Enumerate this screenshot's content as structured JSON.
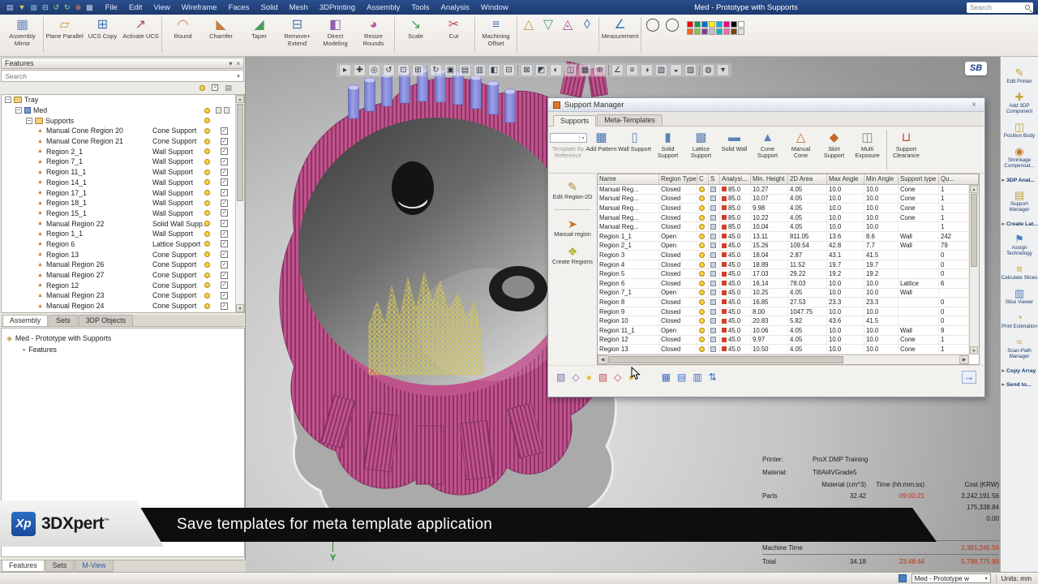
{
  "titlebar": {
    "title": "Med - Prototype with Supports",
    "menus": [
      "File",
      "Edit",
      "View",
      "Wireframe",
      "Faces",
      "Solid",
      "Mesh",
      "3DPrinting",
      "Assembly",
      "Tools",
      "Analysis",
      "Window"
    ],
    "search_placeholder": "Search",
    "quick_icons": [
      {
        "name": "new-file-icon",
        "glyph": "▤",
        "color": "#cdd6e8"
      },
      {
        "name": "open-file-icon",
        "glyph": "▼",
        "color": "#e8c46a"
      },
      {
        "name": "save-icon",
        "glyph": "▦",
        "color": "#7fa8d8"
      },
      {
        "name": "print-icon",
        "glyph": "⊟",
        "color": "#cdd6e8"
      },
      {
        "name": "undo-icon",
        "glyph": "↺",
        "color": "#9fd88a"
      },
      {
        "name": "redo-icon",
        "glyph": "↻",
        "color": "#9fd88a"
      },
      {
        "name": "ucs-icon",
        "glyph": "⊕",
        "color": "#e8886a"
      },
      {
        "name": "grid-icon",
        "glyph": "▩",
        "color": "#cdd6e8"
      }
    ]
  },
  "ribbon": {
    "items": [
      {
        "label": "Assembly Mirror",
        "glyph": "▦",
        "color": "#6f8fbf",
        "sep": true
      },
      {
        "label": "Plane Parallel",
        "glyph": "▱",
        "color": "#c79a3a"
      },
      {
        "label": "UCS Copy",
        "glyph": "⊞",
        "color": "#4472b0"
      },
      {
        "label": "Activate UCS",
        "glyph": "↗",
        "color": "#b05050",
        "sep": true
      },
      {
        "label": "Round",
        "glyph": "◠",
        "color": "#c77d46"
      },
      {
        "label": "Chamfer",
        "glyph": "◣",
        "color": "#c77d46"
      },
      {
        "label": "Taper",
        "glyph": "◢",
        "color": "#4a9e5c"
      },
      {
        "label": "Remove+ Extend",
        "glyph": "⊟",
        "color": "#4472b0"
      },
      {
        "label": "Direct Modeling",
        "glyph": "◧",
        "color": "#8f5fb0"
      },
      {
        "label": "Resize Rounds",
        "glyph": "◕",
        "color": "#b0569a",
        "sep": true
      },
      {
        "label": "Scale",
        "glyph": "↘",
        "color": "#4a9e5c"
      },
      {
        "label": "Cut",
        "glyph": "✂",
        "color": "#b05050",
        "sep": true
      },
      {
        "label": "Machining Offset",
        "glyph": "≡",
        "color": "#4472b0",
        "sep": true
      },
      {
        "label": "",
        "glyph": "△",
        "color": "#c79a3a"
      },
      {
        "label": "",
        "glyph": "▽",
        "color": "#4a9e5c"
      },
      {
        "label": "",
        "glyph": "◬",
        "color": "#b0569a"
      },
      {
        "label": "",
        "glyph": "◊",
        "color": "#4472b0",
        "sep": true
      },
      {
        "label": "Measurement",
        "glyph": "∠",
        "color": "#3a7ec2",
        "sep": true
      },
      {
        "label": "",
        "glyph": "◯",
        "color": "#555555"
      },
      {
        "label": "",
        "glyph": "◯",
        "color": "#555555"
      }
    ],
    "palette": [
      "#ff0000",
      "#00a650",
      "#0072bc",
      "#fff200",
      "#00aeef",
      "#ec008c",
      "#000000",
      "#ffffff",
      "#f26522",
      "#8dc63f",
      "#7d4199",
      "#c0c0c0",
      "#00b7c6",
      "#f06eaa",
      "#804000",
      "#e0e0e0"
    ]
  },
  "viewport_toolbar": [
    {
      "name": "select-icon",
      "glyph": "▸"
    },
    {
      "name": "pan-icon",
      "glyph": "✚"
    },
    {
      "name": "zoom-icon",
      "glyph": "◎"
    },
    {
      "name": "rotate-icon",
      "glyph": "↺"
    },
    {
      "name": "zoom-fit-icon",
      "glyph": "⊡"
    },
    {
      "name": "zoom-window-icon",
      "glyph": "⊞"
    },
    {
      "name": "previous-view-icon",
      "glyph": "↻"
    },
    {
      "name": "shade-icon",
      "glyph": "▣"
    },
    {
      "name": "wireframe-icon",
      "glyph": "▤"
    },
    {
      "name": "hidden-line-icon",
      "glyph": "▥"
    },
    {
      "name": "perspective-icon",
      "glyph": "◧"
    },
    {
      "name": "view-top-icon",
      "glyph": "⊟"
    },
    {
      "name": "view-front-icon",
      "glyph": "⊠"
    },
    {
      "name": "view-iso-icon",
      "glyph": "◩"
    },
    {
      "name": "light-icon",
      "glyph": "◐"
    },
    {
      "name": "section-icon",
      "glyph": "◫"
    },
    {
      "name": "grid-toggle-icon",
      "glyph": "▦"
    },
    {
      "name": "ucs-toggle-icon",
      "glyph": "⊕"
    },
    {
      "name": "axis-icon",
      "glyph": "∠"
    },
    {
      "name": "measure-icon",
      "glyph": "≡"
    },
    {
      "name": "display-mode-icon",
      "glyph": "◑"
    },
    {
      "name": "layers-icon",
      "glyph": "▧"
    },
    {
      "name": "background-icon",
      "glyph": "◒"
    },
    {
      "name": "snapshot-icon",
      "glyph": "▨"
    },
    {
      "name": "settings-icon",
      "glyph": "◍"
    },
    {
      "name": "more-icon",
      "glyph": "▾"
    }
  ],
  "features_panel": {
    "title": "Features",
    "search_placeholder": "Search",
    "tabs": [
      "Assembly",
      "Sets",
      "3DP Objects"
    ],
    "tree": [
      {
        "label": "Tray",
        "level": 0,
        "expander": true,
        "icon": "folder"
      },
      {
        "label": "Med",
        "level": 1,
        "expander": true,
        "icon": "part"
      },
      {
        "label": "Supports",
        "level": 2,
        "expander": true,
        "icon": "folder"
      },
      {
        "label": "Manual Cone Region 20",
        "type": "Cone Support",
        "level": 3
      },
      {
        "label": "Manual Cone Region 21",
        "type": "Cone Support",
        "level": 3
      },
      {
        "label": "Region 2_1",
        "type": "Wall Support",
        "level": 3
      },
      {
        "label": "Region 7_1",
        "type": "Wall Support",
        "level": 3
      },
      {
        "label": "Region 11_1",
        "type": "Wall Support",
        "level": 3
      },
      {
        "label": "Region 14_1",
        "type": "Wall Support",
        "level": 3
      },
      {
        "label": "Region 17_1",
        "type": "Wall Support",
        "level": 3
      },
      {
        "label": "Region 18_1",
        "type": "Wall Support",
        "level": 3
      },
      {
        "label": "Region 15_1",
        "type": "Wall Support",
        "level": 3
      },
      {
        "label": "Manual Region 22",
        "type": "Solid Wall Supp...",
        "level": 3
      },
      {
        "label": "Region 1_1",
        "type": "Wall Support",
        "level": 3
      },
      {
        "label": "Region 6",
        "type": "Lattice Support",
        "level": 3
      },
      {
        "label": "Region 13",
        "type": "Cone Support",
        "level": 3
      },
      {
        "label": "Manual Region 26",
        "type": "Cone Support",
        "level": 3
      },
      {
        "label": "Manual Region 27",
        "type": "Cone Support",
        "level": 3
      },
      {
        "label": "Region 12",
        "type": "Cone Support",
        "level": 3
      },
      {
        "label": "Manual Region 23",
        "type": "Cone Support",
        "level": 3
      },
      {
        "label": "Manual Region 24",
        "type": "Cone Support",
        "level": 3
      }
    ]
  },
  "assembly_panel": {
    "root": "Med - Prototype with Supports",
    "child": "Features"
  },
  "bottom_tabs": [
    "Features",
    "Sets",
    "M-View"
  ],
  "support_manager": {
    "title": "Support Manager",
    "tabs": [
      "Supports",
      "Meta-Templates"
    ],
    "toolbar": [
      {
        "label": "Template By Reference",
        "glyph": "▤",
        "color": "#999999",
        "disabled": true
      },
      {
        "label": "Add Pattern",
        "glyph": "▦",
        "color": "#4472b0"
      },
      {
        "label": "Wall Support",
        "glyph": "▯",
        "color": "#5a83b5"
      },
      {
        "label": "Solid Support",
        "glyph": "▮",
        "color": "#5a83b5"
      },
      {
        "label": "Lattice Support",
        "glyph": "▩",
        "color": "#5a83b5"
      },
      {
        "label": "Solid Wall",
        "glyph": "▬",
        "color": "#5a83b5"
      },
      {
        "label": "Cone Support",
        "glyph": "▲",
        "color": "#5a83b5"
      },
      {
        "label": "Manual Cone",
        "glyph": "△",
        "color": "#c26a2a"
      },
      {
        "label": "Skirt Support",
        "glyph": "◆",
        "color": "#c26a2a"
      },
      {
        "label": "Multi Exposure",
        "glyph": "◫",
        "color": "#888888",
        "sep_after": true
      },
      {
        "label": "Support Clearance",
        "glyph": "⊔",
        "color": "#c24a2a"
      }
    ],
    "side_tools": [
      {
        "label": "Edit Region-2D",
        "glyph": "✎",
        "color": "#b08a2a"
      },
      {
        "label": "Manual region",
        "glyph": "➤",
        "color": "#c2742a"
      },
      {
        "label": "Create Regions",
        "glyph": "❖",
        "color": "#b0b02a"
      }
    ],
    "table": {
      "columns": [
        "Name",
        "Region Type",
        "C",
        "S",
        "Analysi...",
        "Min. Height",
        "2D Area",
        "Max Angle",
        "Min Angle",
        "Support type",
        "Qu..."
      ],
      "rows": [
        {
          "name": "Manual Reg...",
          "region_type": "Closed",
          "analysis": "85.0",
          "min_height": "10.27",
          "area": "4.05",
          "max_angle": "10.0",
          "min_angle": "10.0",
          "support_type": "Cone",
          "qty": "1"
        },
        {
          "name": "Manual Reg...",
          "region_type": "Closed",
          "analysis": "85.0",
          "min_height": "10.07",
          "area": "4.05",
          "max_angle": "10.0",
          "min_angle": "10.0",
          "support_type": "Cone",
          "qty": "1"
        },
        {
          "name": "Manual Reg...",
          "region_type": "Closed",
          "analysis": "85.0",
          "min_height": "9.98",
          "area": "4.05",
          "max_angle": "10.0",
          "min_angle": "10.0",
          "support_type": "Cone",
          "qty": "1"
        },
        {
          "name": "Manual Reg...",
          "region_type": "Closed",
          "analysis": "85.0",
          "min_height": "10.22",
          "area": "4.05",
          "max_angle": "10.0",
          "min_angle": "10.0",
          "support_type": "Cone",
          "qty": "1"
        },
        {
          "name": "Manual Reg...",
          "region_type": "Closed",
          "analysis": "85.0",
          "min_height": "10.04",
          "area": "4.05",
          "max_angle": "10.0",
          "min_angle": "10.0",
          "support_type": "",
          "qty": "1"
        },
        {
          "name": "Region 1_1",
          "region_type": "Open",
          "analysis": "45.0",
          "min_height": "13.11",
          "area": "811.05",
          "max_angle": "13.6",
          "min_angle": "8.6",
          "support_type": "Wall",
          "qty": "242"
        },
        {
          "name": "Region 2_1",
          "region_type": "Open",
          "analysis": "45.0",
          "min_height": "15.26",
          "area": "109.54",
          "max_angle": "42.8",
          "min_angle": "7.7",
          "support_type": "Wall",
          "qty": "79"
        },
        {
          "name": "Region 3",
          "region_type": "Closed",
          "analysis": "45.0",
          "min_height": "18.04",
          "area": "2.87",
          "max_angle": "43.1",
          "min_angle": "41.5",
          "support_type": "",
          "qty": "0"
        },
        {
          "name": "Region 4",
          "region_type": "Closed",
          "analysis": "45.0",
          "min_height": "18.89",
          "area": "11.52",
          "max_angle": "19.7",
          "min_angle": "19.7",
          "support_type": "",
          "qty": "0"
        },
        {
          "name": "Region 5",
          "region_type": "Closed",
          "analysis": "45.0",
          "min_height": "17.03",
          "area": "29.22",
          "max_angle": "19.2",
          "min_angle": "19.2",
          "support_type": "",
          "qty": "0"
        },
        {
          "name": "Region 6",
          "region_type": "Closed",
          "analysis": "45.0",
          "min_height": "16.14",
          "area": "78.03",
          "max_angle": "10.0",
          "min_angle": "10.0",
          "support_type": "Lattice",
          "qty": "6"
        },
        {
          "name": "Region 7_1",
          "region_type": "Open",
          "analysis": "45.0",
          "min_height": "10.25",
          "area": "4.05",
          "max_angle": "10.0",
          "min_angle": "10.0",
          "support_type": "Wall",
          "qty": ""
        },
        {
          "name": "Region 8",
          "region_type": "Closed",
          "analysis": "45.0",
          "min_height": "16.85",
          "area": "27.53",
          "max_angle": "23.3",
          "min_angle": "23.3",
          "support_type": "",
          "qty": "0"
        },
        {
          "name": "Region 9",
          "region_type": "Closed",
          "analysis": "45.0",
          "min_height": "8.00",
          "area": "1047.75",
          "max_angle": "10.0",
          "min_angle": "10.0",
          "support_type": "",
          "qty": "0"
        },
        {
          "name": "Region 10",
          "region_type": "Closed",
          "analysis": "45.0",
          "min_height": "20.83",
          "area": "5.82",
          "max_angle": "43.6",
          "min_angle": "41.5",
          "support_type": "",
          "qty": "0"
        },
        {
          "name": "Region 11_1",
          "region_type": "Open",
          "analysis": "45.0",
          "min_height": "10.06",
          "area": "4.05",
          "max_angle": "10.0",
          "min_angle": "10.0",
          "support_type": "Wall",
          "qty": "9"
        },
        {
          "name": "Region 12",
          "region_type": "Closed",
          "analysis": "45.0",
          "min_height": "9.97",
          "area": "4.05",
          "max_angle": "10.0",
          "min_angle": "10.0",
          "support_type": "Cone",
          "qty": "1"
        },
        {
          "name": "Region 13",
          "region_type": "Closed",
          "analysis": "45.0",
          "min_height": "10.50",
          "area": "4.05",
          "max_angle": "10.0",
          "min_angle": "10.0",
          "support_type": "Cone",
          "qty": "1"
        }
      ]
    },
    "bottom_toolbar": [
      {
        "name": "show-solid-icon",
        "glyph": "▧",
        "color": "#7a6ab0"
      },
      {
        "name": "show-region-icon",
        "glyph": "◇",
        "color": "#7a6ab0"
      },
      {
        "name": "highlight-on-icon",
        "glyph": "●",
        "color": "#e8c53a"
      },
      {
        "name": "hide-solid-icon",
        "glyph": "▧",
        "color": "#c05050"
      },
      {
        "name": "hide-region-icon",
        "glyph": "◇",
        "color": "#c05050"
      },
      {
        "name": "highlight-off-icon",
        "glyph": "●",
        "color": "#e8c53a",
        "sep": true
      },
      {
        "name": "table-view-icon",
        "glyph": "▦",
        "color": "#3a6ec2"
      },
      {
        "name": "table-edit-icon",
        "glyph": "▤",
        "color": "#3a6ec2"
      },
      {
        "name": "table-filter-icon",
        "glyph": "▥",
        "color": "#3a6ec2"
      },
      {
        "name": "sort-ascending-icon",
        "glyph": "⇅",
        "color": "#3a6ec2"
      }
    ],
    "apply_glyph": "→"
  },
  "right_sidebar": [
    {
      "label": "Edit Printer",
      "glyph": "✎",
      "color": "#c7a23a"
    },
    {
      "label": "Add 3DP Component",
      "glyph": "✚",
      "color": "#c7a23a"
    },
    {
      "label": "Position Body",
      "glyph": "◫",
      "color": "#c7a23a"
    },
    {
      "label": "Shrinkage Compensat...",
      "glyph": "◉",
      "color": "#c7762a"
    },
    {
      "label": "3DP Anal...",
      "group": true
    },
    {
      "label": "Support Manager",
      "glyph": "▤",
      "color": "#c7a23a"
    },
    {
      "label": "Create Lat...",
      "group": true
    },
    {
      "label": "Assign Technology",
      "glyph": "⚑",
      "color": "#4a7ec2"
    },
    {
      "label": "Calculate Slices",
      "glyph": "≡",
      "color": "#c7a23a"
    },
    {
      "label": "Slice Viewer",
      "glyph": "▥",
      "color": "#4a7ec2"
    },
    {
      "label": "Print Estimation",
      "glyph": "◔",
      "color": "#c7a23a"
    },
    {
      "label": "Scan-Path Manager",
      "glyph": "≈",
      "color": "#c7a23a"
    },
    {
      "label": "Copy Array",
      "group": true
    },
    {
      "label": "Send to...",
      "group": true
    }
  ],
  "build_info": {
    "printer_label": "Printer:",
    "printer_value": "ProX DMP Training",
    "material_label": "Material:",
    "material_value": "Ti6Al4VGrade5",
    "col_headers": [
      "Material (cm^3)",
      "Time (hh:mm:ss)",
      "Cost (KRW)"
    ],
    "rows": [
      {
        "label": "Parts",
        "material": "32.42",
        "time": "09:00:21",
        "cost": "3,242,191.56",
        "time_red": true
      },
      {
        "label": "",
        "material": "",
        "time": "",
        "cost": "175,338.84"
      },
      {
        "label": "",
        "material": "",
        "time": "",
        "cost": "0.00"
      },
      {
        "label": "Machine Time",
        "material": "",
        "time": "",
        "cost": "2,381,245.59",
        "cost_red": true,
        "gap_above": true,
        "sep_above": true
      },
      {
        "label": "Total",
        "material": "34.18",
        "time": "23:48:44",
        "cost": "5,798,775.99",
        "time_red": true,
        "cost_red": true,
        "sep_above": true
      }
    ]
  },
  "banner": {
    "logo": "Xp",
    "brand": "3DXpert",
    "tm": "™",
    "message": "Save templates for meta template application"
  },
  "badge": "SB",
  "axis": "Y",
  "status_bar": {
    "doc": "Med - Prototype w",
    "units": "Units: mm"
  }
}
